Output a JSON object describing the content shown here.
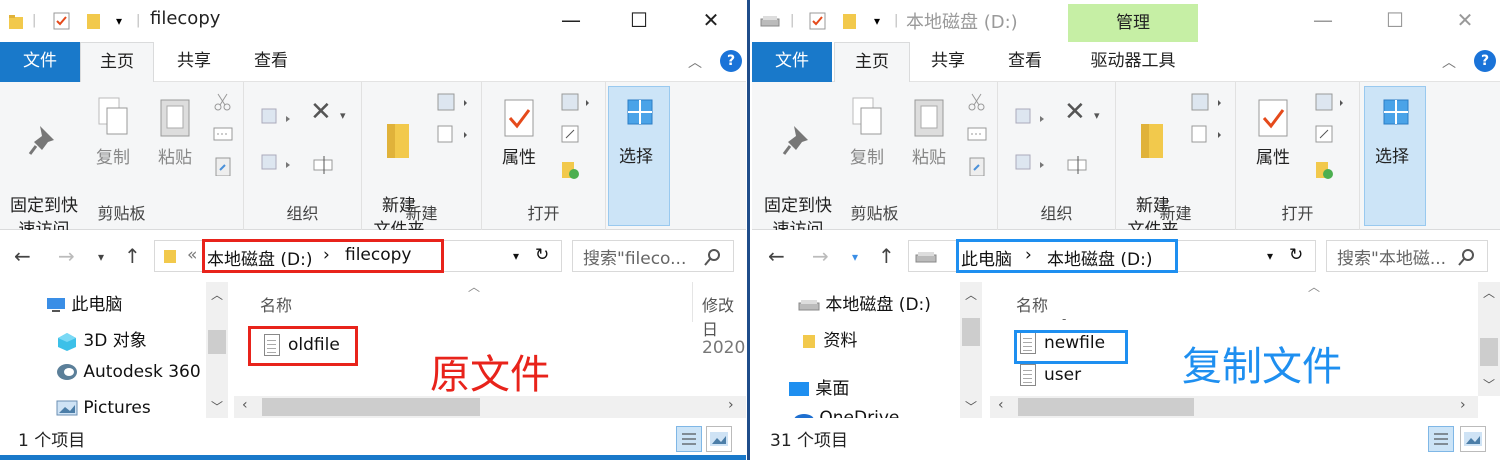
{
  "colors": {
    "file_tab": "#1979ca",
    "red_box": "#e8231b",
    "blue_box": "#1e8ff0",
    "manage_bg": "#c6efa5"
  },
  "left": {
    "title": "filecopy",
    "tabs": {
      "file": "文件",
      "home": "主页",
      "share": "共享",
      "view": "查看"
    },
    "help": "?",
    "ribbon": {
      "pin": "固定到快\n速访问",
      "copy": "复制",
      "paste": "粘贴",
      "group_clipboard": "剪贴板",
      "group_organize": "组织",
      "new_folder": "新建\n文件夹",
      "group_new": "新建",
      "properties": "属性",
      "group_open": "打开",
      "select": "选择"
    },
    "address": {
      "prefix": "«",
      "crumb1": "本地磁盘 (D:)",
      "sep": "›",
      "crumb2": "filecopy"
    },
    "search_placeholder": "搜索\"fileco...",
    "nav": {
      "this_pc": "此电脑",
      "objects3d": "3D 对象",
      "autodesk": "Autodesk 360",
      "pictures": "Pictures"
    },
    "list": {
      "col_name": "名称",
      "col_modified": "修改日",
      "file1": "oldfile",
      "date1": "2020"
    },
    "annotation": "原文件",
    "status": "1 个项目"
  },
  "right": {
    "title": "本地磁盘 (D:)",
    "manage": "管理",
    "tabs": {
      "file": "文件",
      "home": "主页",
      "share": "共享",
      "view": "查看",
      "drive_tools": "驱动器工具"
    },
    "help": "?",
    "ribbon": {
      "pin": "固定到快\n速访问",
      "copy": "复制",
      "paste": "粘贴",
      "group_clipboard": "剪贴板",
      "group_organize": "组织",
      "new_folder": "新建\n文件夹",
      "group_new": "新建",
      "properties": "属性",
      "group_open": "打开",
      "select": "选择"
    },
    "address": {
      "crumb1": "此电脑",
      "sep": "›",
      "crumb2": "本地磁盘 (D:)"
    },
    "search_placeholder": "搜索\"本地磁...",
    "nav": {
      "disk": "本地磁盘 (D:)",
      "materials": "资料",
      "desktop": "桌面",
      "onedrive": "OneDrive"
    },
    "list": {
      "col_name": "名称",
      "file_partial": "-",
      "file1": "newfile",
      "file2": "user"
    },
    "annotation": "复制文件",
    "status": "31 个项目"
  }
}
